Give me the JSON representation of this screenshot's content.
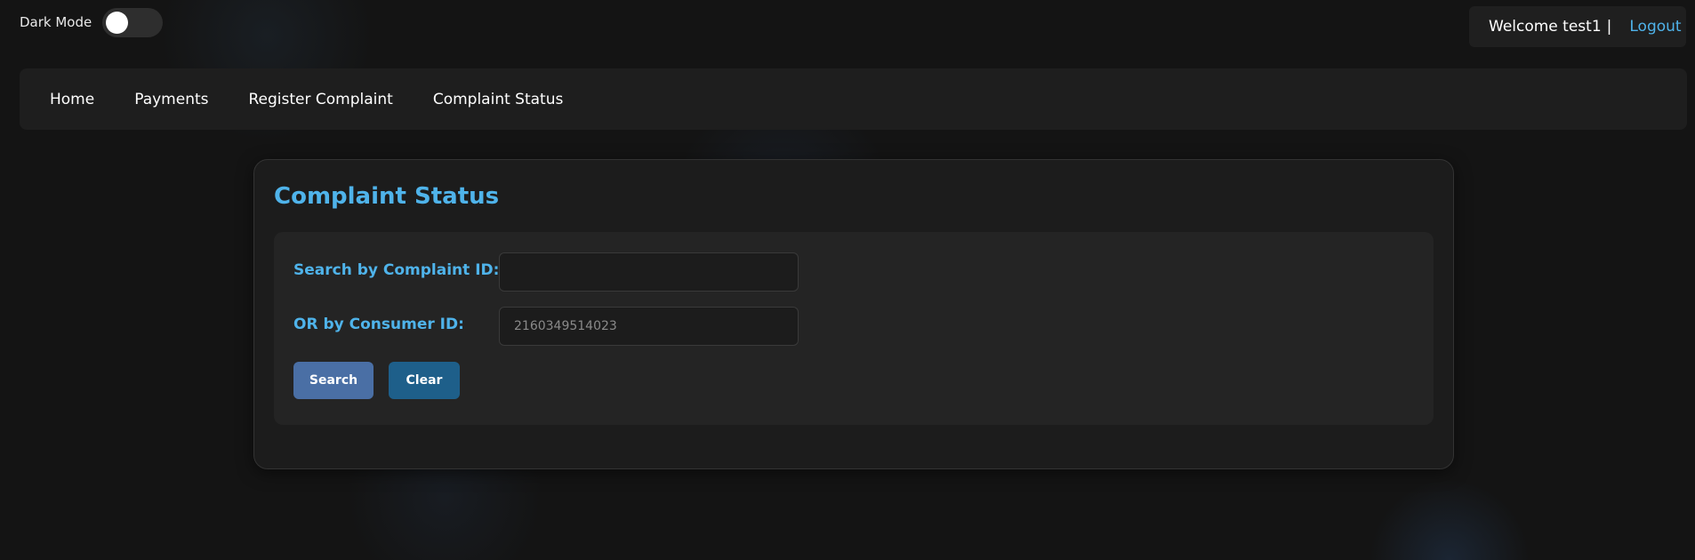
{
  "header": {
    "dark_mode_label": "Dark Mode",
    "dark_mode_on": false,
    "welcome_text": "Welcome test1",
    "separator": "|",
    "logout_label": "Logout"
  },
  "nav": {
    "items": [
      {
        "label": "Home"
      },
      {
        "label": "Payments"
      },
      {
        "label": "Register Complaint"
      },
      {
        "label": "Complaint Status"
      }
    ]
  },
  "main": {
    "title": "Complaint Status",
    "form": {
      "complaint_id_label": "Search by Complaint ID:",
      "complaint_id_value": "",
      "consumer_id_label": "OR by Consumer ID:",
      "consumer_id_placeholder": "2160349514023",
      "search_label": "Search",
      "clear_label": "Clear"
    }
  },
  "colors": {
    "accent": "#4fb3ea",
    "background": "#141414",
    "search_button": "#4a6fa5",
    "clear_button": "#1e5f8a"
  }
}
